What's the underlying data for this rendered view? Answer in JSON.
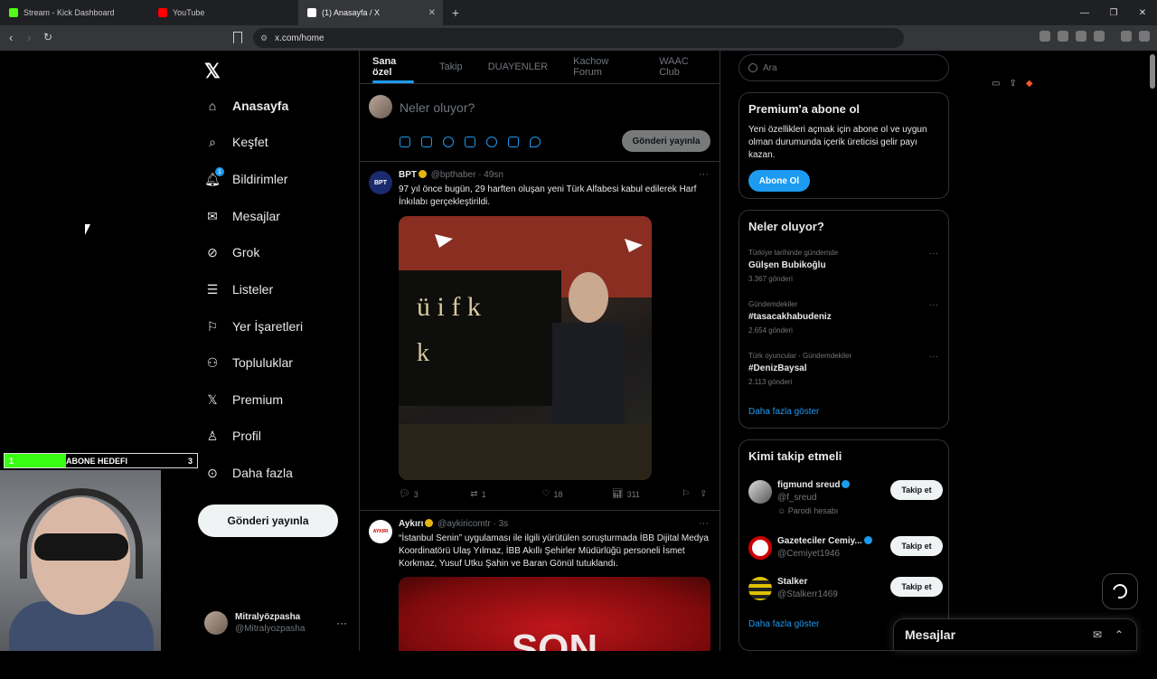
{
  "browser": {
    "tabs": [
      {
        "title": "Stream - Kick Dashboard",
        "color": "#53fc18"
      },
      {
        "title": "YouTube",
        "color": "#ff0000"
      },
      {
        "title": "(1) Anasayfa / X",
        "color": "#ffffff"
      }
    ],
    "url": "x.com/home"
  },
  "nav": {
    "items": [
      {
        "label": "Anasayfa",
        "icon": "home-icon"
      },
      {
        "label": "Keşfet",
        "icon": "search-icon"
      },
      {
        "label": "Bildirimler",
        "icon": "bell-icon",
        "badge": "1"
      },
      {
        "label": "Mesajlar",
        "icon": "mail-icon"
      },
      {
        "label": "Grok",
        "icon": "grok-icon"
      },
      {
        "label": "Listeler",
        "icon": "list-icon"
      },
      {
        "label": "Yer İşaretleri",
        "icon": "bookmark-icon"
      },
      {
        "label": "Topluluklar",
        "icon": "communities-icon"
      },
      {
        "label": "Premium",
        "icon": "x-icon"
      },
      {
        "label": "Profil",
        "icon": "person-icon"
      },
      {
        "label": "Daha fazla",
        "icon": "more-circle-icon"
      }
    ],
    "post_button": "Gönderi yayınla",
    "account": {
      "name": "Mitralyözpasha",
      "handle": "@Mitralyozpasha"
    }
  },
  "overlay": {
    "goal_start": "1",
    "goal_label": "ABONE HEDEFI",
    "goal_end": "3",
    "goal_progress": 0.32
  },
  "feed": {
    "tabs": [
      "Sana özel",
      "Takip",
      "DUAYENLER",
      "Kachow Forum",
      "WAAC Club"
    ],
    "compose_placeholder": "Neler oluyor?",
    "compose_button": "Gönderi yayınla",
    "posts": [
      {
        "name": "BPT",
        "handle": "@bpthaber · 49sn",
        "avatar_text": "BPT",
        "text": "97 yıl önce bugün, 29 harften oluşan yeni Türk Alfabesi kabul edilerek Harf İnkılabı gerçekleştirildi.",
        "replies": "3",
        "reposts": "1",
        "likes": "18",
        "views": "311"
      },
      {
        "name": "Aykırı",
        "handle": "@aykiricomtr · 3s",
        "avatar_text": "AYKIRI",
        "text": "“İstanbul Senin” uygulaması ile ilgili yürütülen soruşturmada İBB Dijital Medya Koordinatörü Ulaş Yılmaz, İBB Akıllı Şehirler Müdürlüğü personeli İsmet Korkmaz, Yusuf Utku Şahin ve Baran Gönül tutuklandı.",
        "media_text": "SON"
      }
    ]
  },
  "sidebar": {
    "search_placeholder": "Ara",
    "premium": {
      "title": "Premium'a abone ol",
      "desc": "Yeni özellikleri açmak için abone ol ve uygun olman durumunda içerik üreticisi gelir payı kazan.",
      "button": "Abone Ol"
    },
    "trends": {
      "title": "Neler oluyor?",
      "items": [
        {
          "context": "Türkiye tarihinde gündemde",
          "topic": "Gülşen Bubikoğlu",
          "count": "3.367 gönderi"
        },
        {
          "context": "Gündemdekiler",
          "topic": "#tasacakhabudeniz",
          "count": "2.654 gönderi"
        },
        {
          "context": "Türk oyuncular · Gündemdekiler",
          "topic": "#DenizBaysal",
          "count": "2.113 gönderi"
        }
      ],
      "show_more": "Daha fazla göster"
    },
    "who_to_follow": {
      "title": "Kimi takip etmeli",
      "items": [
        {
          "name": "figmund sreud",
          "handle": "@f_sreud",
          "extra": "Parodi hesabı",
          "button": "Takip et"
        },
        {
          "name": "Gazeteciler Cemiy...",
          "handle": "@Cemiyet1946",
          "extra": "",
          "button": "Takip et"
        },
        {
          "name": "Stalker",
          "handle": "@Stalkerr1469",
          "extra": "",
          "button": "Takip et"
        }
      ],
      "show_more": "Daha fazla göster"
    }
  },
  "messages_drawer": {
    "title": "Mesajlar"
  }
}
